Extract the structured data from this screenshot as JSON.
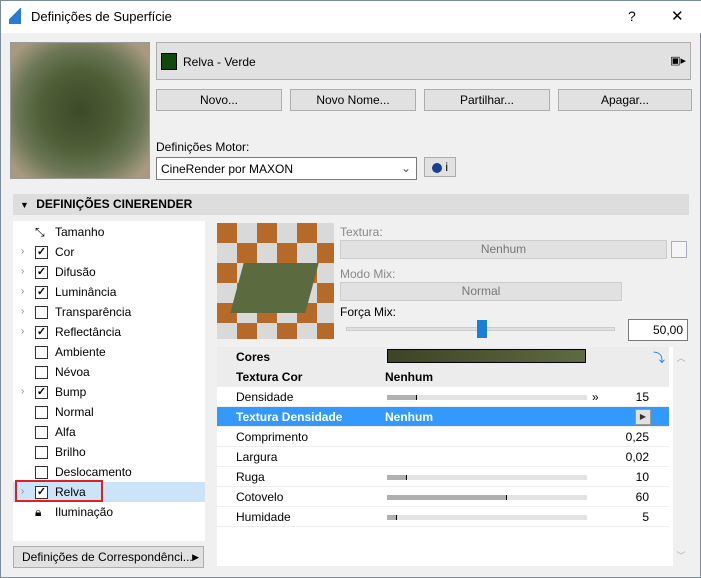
{
  "window": {
    "title": "Definições de Superfície",
    "help": "?",
    "close": "✕"
  },
  "surface": {
    "name": "Relva - Verde",
    "swatch": "#0f4a0a"
  },
  "buttons": {
    "new": "Novo...",
    "rename": "Novo Nome...",
    "share": "Partilhar...",
    "delete": "Apagar..."
  },
  "engine": {
    "label": "Definições Motor:",
    "value": "CineRender por MAXON",
    "info": "i"
  },
  "section": {
    "title": "DEFINIÇÕES CINERENDER"
  },
  "channels": [
    {
      "label": "Tamanho",
      "type": "size"
    },
    {
      "label": "Cor",
      "checked": true,
      "expand": true
    },
    {
      "label": "Difusão",
      "checked": true,
      "expand": true
    },
    {
      "label": "Luminância",
      "checked": true,
      "expand": true
    },
    {
      "label": "Transparência",
      "checked": false,
      "expand": true
    },
    {
      "label": "Reflectância",
      "checked": true,
      "expand": true
    },
    {
      "label": "Ambiente",
      "checked": false
    },
    {
      "label": "Névoa",
      "checked": false
    },
    {
      "label": "Bump",
      "checked": true,
      "expand": true
    },
    {
      "label": "Normal",
      "checked": false
    },
    {
      "label": "Alfa",
      "checked": false
    },
    {
      "label": "Brilho",
      "checked": false
    },
    {
      "label": "Deslocamento",
      "checked": false
    },
    {
      "label": "Relva",
      "checked": true,
      "expand": true,
      "selected": true
    },
    {
      "label": "Iluminação",
      "type": "lock"
    }
  ],
  "mapping_button": "Definições de Correspondênci...",
  "texture": {
    "label": "Textura:",
    "value": "Nenhum",
    "mix_mode_label": "Modo Mix:",
    "mix_mode": "Normal",
    "mix_strength_label": "Força Mix:",
    "mix_strength": "50,00",
    "mix_strength_fraction": 0.5
  },
  "grass": {
    "colors_label": "Cores",
    "rows": [
      {
        "label": "Textura Cor",
        "mid": "Nenhum",
        "bold": true
      },
      {
        "label": "Densidade",
        "value": "15",
        "fraction": 0.15
      },
      {
        "label": "Textura Densidade",
        "mid": "Nenhum",
        "selected": true
      },
      {
        "label": "Comprimento",
        "value": "0,25"
      },
      {
        "label": "Largura",
        "value": "0,02"
      },
      {
        "label": "Ruga",
        "value": "10",
        "fraction": 0.1
      },
      {
        "label": "Cotovelo",
        "value": "60",
        "fraction": 0.6
      },
      {
        "label": "Humidade",
        "value": "5",
        "fraction": 0.05
      }
    ]
  }
}
